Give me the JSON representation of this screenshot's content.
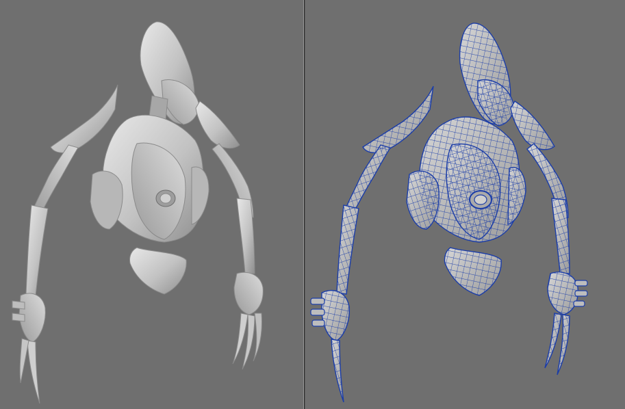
{
  "viewports": [
    {
      "id": "left",
      "shading": "smooth-shaded",
      "wireframe": false
    },
    {
      "id": "right",
      "shading": "smooth-shaded",
      "wireframe": true
    }
  ],
  "colors": {
    "background": "#6f6f6f",
    "mesh_fill": "#c4c4c4",
    "mesh_shadow": "#8e8e8e",
    "mesh_highlight": "#e6e6e6",
    "wire": "#1b3da8"
  }
}
